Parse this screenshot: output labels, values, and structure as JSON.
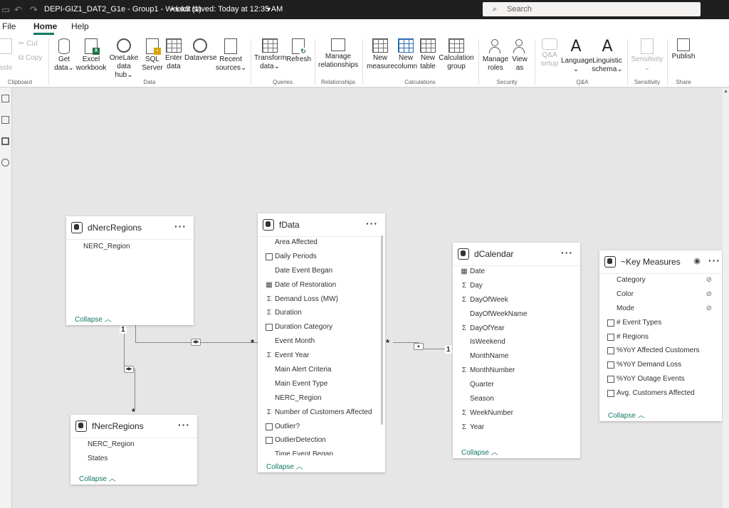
{
  "titlebar": {
    "file_title": "DEPI-GIZ1_DAT2_G1e - Group1 - Week3 (1)",
    "saved_status": "Last saved: Today at 12:35 AM",
    "search_placeholder": "Search"
  },
  "menu": {
    "file": "File",
    "home": "Home",
    "help": "Help"
  },
  "ribbon": {
    "clipboard": {
      "paste": "aste",
      "cut": "Cut",
      "copy": "Copy",
      "group": "Clipboard"
    },
    "data": {
      "get_data": "Get",
      "get_data2": "data",
      "excel": "Excel",
      "excel2": "workbook",
      "onelake": "OneLake",
      "onelake2": "data hub",
      "sql": "SQL",
      "sql2": "Server",
      "enter": "Enter",
      "enter2": "data",
      "dataverse": "Dataverse",
      "recent": "Recent",
      "recent2": "sources",
      "group": "Data"
    },
    "queries": {
      "transform": "Transform",
      "transform2": "data",
      "refresh": "Refresh",
      "group": "Queries"
    },
    "relationships": {
      "manage": "Manage",
      "manage2": "relationships",
      "group": "Relationships"
    },
    "calculations": {
      "new_measure": "New",
      "new_measure2": "measure",
      "new_column": "New",
      "new_column2": "column",
      "new_table": "New",
      "new_table2": "table",
      "calc_group": "Calculation",
      "calc_group2": "group",
      "group": "Calculations"
    },
    "security": {
      "manage_roles": "Manage",
      "manage_roles2": "roles",
      "view_as": "View",
      "view_as2": "as",
      "group": "Security"
    },
    "qa": {
      "setup": "Q&A",
      "setup2": "setup",
      "language": "Language",
      "linguistic": "Linguistic",
      "linguistic2": "schema",
      "group": "Q&A"
    },
    "sensitivity": {
      "label": "Sensitivity",
      "group": "Sensitivity"
    },
    "share": {
      "publish": "Publish",
      "group": "Share"
    }
  },
  "tables": {
    "dNercRegions": {
      "title": "dNercRegions",
      "fields": [
        {
          "name": "NERC_Region",
          "icon": ""
        }
      ],
      "collapse": "Collapse"
    },
    "fNercRegions": {
      "title": "fNercRegions",
      "fields": [
        {
          "name": "NERC_Region",
          "icon": ""
        },
        {
          "name": "States",
          "icon": ""
        }
      ],
      "collapse": "Collapse"
    },
    "fData": {
      "title": "fData",
      "fields": [
        {
          "name": "Area Affected",
          "icon": ""
        },
        {
          "name": "Daily Periods",
          "icon": "calc"
        },
        {
          "name": "Date Event Began",
          "icon": ""
        },
        {
          "name": "Date of Restoration",
          "icon": "cal"
        },
        {
          "name": "Demand Loss (MW)",
          "icon": "sigma"
        },
        {
          "name": "Duration",
          "icon": "sigma"
        },
        {
          "name": "Duration Category",
          "icon": "calc"
        },
        {
          "name": "Event Month",
          "icon": ""
        },
        {
          "name": "Event Year",
          "icon": "sigma"
        },
        {
          "name": "Main Alert Criteria",
          "icon": ""
        },
        {
          "name": "Main Event Type",
          "icon": ""
        },
        {
          "name": "NERC_Region",
          "icon": ""
        },
        {
          "name": "Number of Customers Affected",
          "icon": "sigma"
        },
        {
          "name": "Outlier?",
          "icon": "calc"
        },
        {
          "name": "OutlierDetection",
          "icon": "calc"
        },
        {
          "name": "Time Event Began",
          "icon": ""
        }
      ],
      "collapse": "Collapse"
    },
    "dCalendar": {
      "title": "dCalendar",
      "fields": [
        {
          "name": "Date",
          "icon": "cal"
        },
        {
          "name": "Day",
          "icon": "sigma"
        },
        {
          "name": "DayOfWeek",
          "icon": "sigma"
        },
        {
          "name": "DayOfWeekName",
          "icon": ""
        },
        {
          "name": "DayOfYear",
          "icon": "sigma"
        },
        {
          "name": "IsWeekend",
          "icon": ""
        },
        {
          "name": "MonthName",
          "icon": ""
        },
        {
          "name": "MonthNumber",
          "icon": "sigma"
        },
        {
          "name": "Quarter",
          "icon": ""
        },
        {
          "name": "Season",
          "icon": ""
        },
        {
          "name": "WeekNumber",
          "icon": "sigma"
        },
        {
          "name": "Year",
          "icon": "sigma"
        }
      ],
      "collapse": "Collapse"
    },
    "keyMeasures": {
      "title": "~Key Measures",
      "fields": [
        {
          "name": "Category",
          "icon": "",
          "hidden": true
        },
        {
          "name": "Color",
          "icon": "",
          "hidden": true
        },
        {
          "name": "Mode",
          "icon": "",
          "hidden": true
        },
        {
          "name": "# Event Types",
          "icon": "calc"
        },
        {
          "name": "# Regions",
          "icon": "calc"
        },
        {
          "name": "%YoY Affected Customers",
          "icon": "calc"
        },
        {
          "name": "%YoY Demand Loss",
          "icon": "calc"
        },
        {
          "name": "%YoY Outage Events",
          "icon": "calc"
        },
        {
          "name": "Avg. Customers Affected",
          "icon": "calc"
        }
      ],
      "collapse": "Collapse"
    }
  },
  "relationships": {
    "one_label": "1",
    "many_label": "*"
  }
}
